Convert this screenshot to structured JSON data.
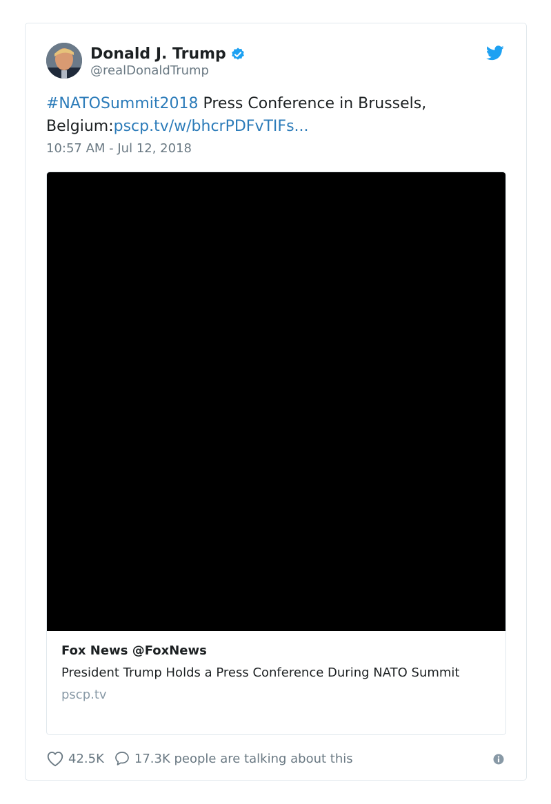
{
  "author": {
    "display_name": "Donald J. Trump",
    "handle": "@realDonaldTrump",
    "verified_icon": "verified-badge-icon",
    "platform_icon": "twitter-bird-icon"
  },
  "tweet": {
    "hashtag": "#NATOSummit2018",
    "text_after_hashtag": " Press Conference in Brussels,",
    "text_line2_prefix": "Belgium:",
    "link": "pscp.tv/w/bhcrPDFvTIFs...",
    "timestamp": "10:57 AM - Jul 12, 2018"
  },
  "media_card": {
    "source": "Fox News @FoxNews",
    "title": "President Trump Holds a Press Conference During NATO Summit",
    "domain": "pscp.tv"
  },
  "actions": {
    "likes": "42.5K",
    "replies_text": "17.3K people are talking about this"
  },
  "colors": {
    "link": "#2b7bb9",
    "verified": "#1da1f2",
    "muted": "#697882"
  }
}
